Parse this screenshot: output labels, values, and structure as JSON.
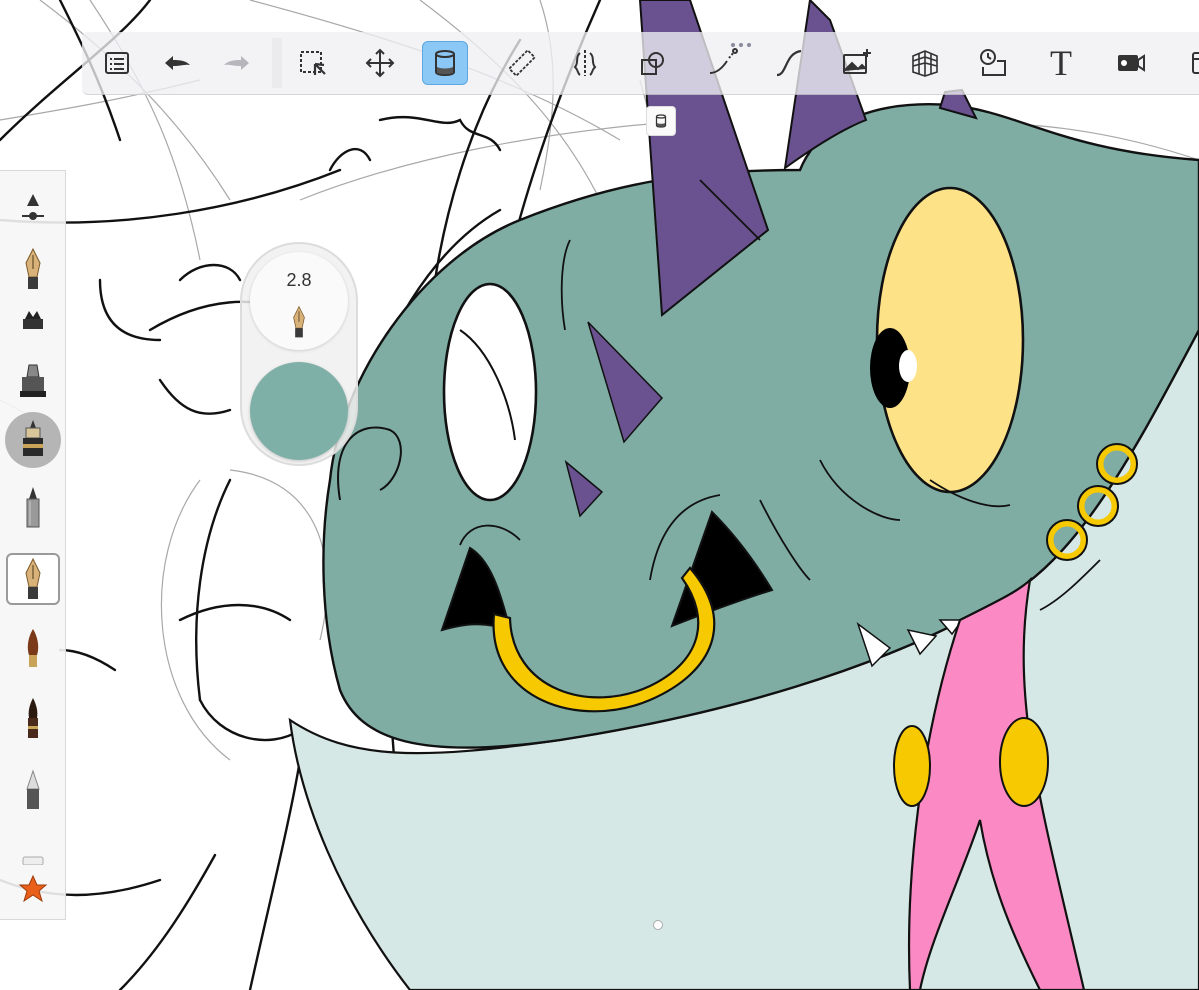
{
  "toolbar": {
    "items": [
      {
        "name": "brush-library-list",
        "icon": "list-icon"
      },
      {
        "name": "undo",
        "icon": "undo-arrow-icon"
      },
      {
        "name": "redo",
        "icon": "redo-arrow-icon"
      },
      {
        "name": "selection",
        "icon": "selection-icon"
      },
      {
        "name": "transform",
        "icon": "move-icon"
      },
      {
        "name": "fill",
        "icon": "paint-bucket-icon",
        "active": true
      },
      {
        "name": "ruler",
        "icon": "ruler-icon"
      },
      {
        "name": "symmetry",
        "icon": "symmetry-icon"
      },
      {
        "name": "shape",
        "icon": "shape-icon"
      },
      {
        "name": "stroke",
        "icon": "predictive-stroke-icon"
      },
      {
        "name": "curve",
        "icon": "curve-icon"
      },
      {
        "name": "import-image",
        "icon": "image-add-icon"
      },
      {
        "name": "perspective",
        "icon": "perspective-grid-icon"
      },
      {
        "name": "time-lapse",
        "icon": "time-lapse-icon"
      },
      {
        "name": "text",
        "icon": "text-icon"
      },
      {
        "name": "record",
        "icon": "video-camera-icon"
      },
      {
        "name": "more",
        "icon": "panel-icon"
      }
    ],
    "text_glyph": "T"
  },
  "brush_puck": {
    "size_value": "2.8",
    "color": "#7fb0a7"
  },
  "colors": {
    "accent_active": "#8cc8f6",
    "skin": "#7fada4",
    "skin_light": "#d6e8e5",
    "horn": "#6a5290",
    "eye": "#fde287",
    "gold": "#f6c900",
    "tongue": "#fb8ac4"
  }
}
